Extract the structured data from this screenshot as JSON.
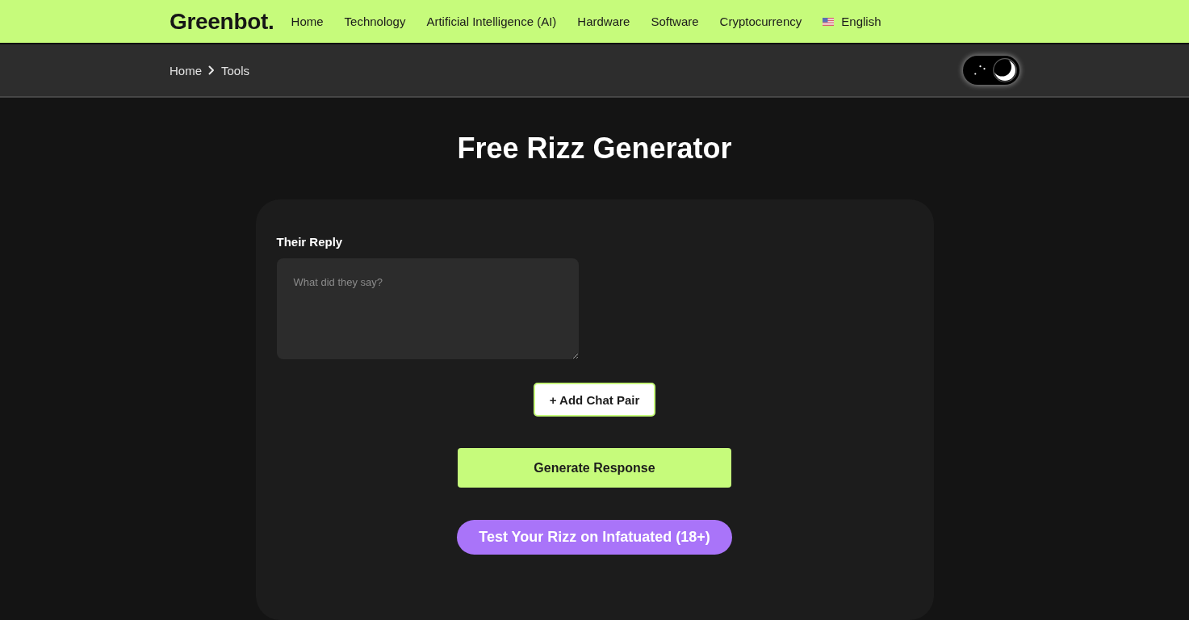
{
  "header": {
    "logo": "Greenbot.",
    "nav": [
      {
        "label": "Home"
      },
      {
        "label": "Technology"
      },
      {
        "label": "Artificial Intelligence (AI)"
      },
      {
        "label": "Hardware"
      },
      {
        "label": "Software"
      },
      {
        "label": "Cryptocurrency"
      }
    ],
    "language": {
      "label": "English"
    }
  },
  "breadcrumb": [
    {
      "label": "Home"
    },
    {
      "label": "Tools"
    }
  ],
  "theme_toggle": {
    "dark": true
  },
  "title": "Free Rizz Generator",
  "form": {
    "fields": [
      {
        "label": "Their Reply",
        "placeholder": "What did they say?"
      }
    ],
    "add_button": "+ Add Chat Pair",
    "generate_button": "Generate Response",
    "promo_button": "Test Your Rizz on Infatuated (18+)"
  }
}
